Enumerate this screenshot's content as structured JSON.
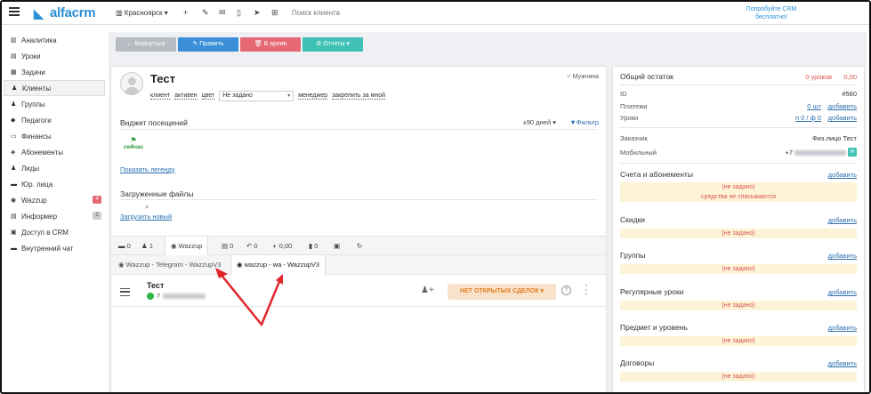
{
  "topbar": {
    "logo": "alfacrm",
    "branch": "Красноярск",
    "search_placeholder": "Поиск клиента",
    "promo": "Попробуйте CRM бесплатно!"
  },
  "sidebar": {
    "items": [
      {
        "label": "Аналитика",
        "icon": "chart-icon"
      },
      {
        "label": "Уроки",
        "icon": "calendar-icon"
      },
      {
        "label": "Задачи",
        "icon": "tasks-icon"
      },
      {
        "label": "Клиенты",
        "icon": "user-icon"
      },
      {
        "label": "Группы",
        "icon": "users-icon"
      },
      {
        "label": "Педагоги",
        "icon": "graduation-cap-icon"
      },
      {
        "label": "Финансы",
        "icon": "money-icon"
      },
      {
        "label": "Абонементы",
        "icon": "tag-icon"
      },
      {
        "label": "Лиды",
        "icon": "lead-icon"
      },
      {
        "label": "Юр. лица",
        "icon": "company-icon"
      },
      {
        "label": "Wazzup",
        "icon": "whatsapp-icon",
        "badge": "4"
      },
      {
        "label": "Информер",
        "icon": "list-icon",
        "badge": "2"
      },
      {
        "label": "Доступ в CRM",
        "icon": "lock-icon"
      },
      {
        "label": "Внутренний чат",
        "icon": "chat-icon"
      }
    ]
  },
  "actions": {
    "back": "← Вернуться",
    "edit": "✎ Править",
    "archive": "🗑 В архив",
    "reports": "⚙ Отчеты ▾"
  },
  "client": {
    "name": "Тест",
    "gender": "Мужчина",
    "status_client": "клиент",
    "status_active": "активен",
    "color": "цвет",
    "manager_value": "Не задано",
    "manager": "менеджер",
    "assign_me": "закрепить за мной"
  },
  "attendance": {
    "title": "Виджет посещений",
    "range": "±90 дней ▾",
    "filter": "Фильтр",
    "flag_label": "сейчас",
    "legend": "Показать легенду"
  },
  "files": {
    "title": "Загруженные файлы",
    "upload": "Загрузить новый"
  },
  "tabs": {
    "items": [
      "0",
      "1",
      "Wazzup",
      "0",
      "0",
      "0,00",
      "0",
      "",
      ""
    ]
  },
  "subtabs": {
    "telegram": "Wazzup - Telegram - WazzupV3",
    "wa": "wazzup - wa - WazzupV3"
  },
  "chat": {
    "name": "Тест",
    "phone_prefix": "7",
    "deals_button": "НЕТ ОТКРЫТЫХ СДЕЛОК"
  },
  "right": {
    "balance_title": "Общий остаток",
    "balance_lessons": "0 уроков",
    "balance_amount": "0,00",
    "id_label": "ID",
    "id_value": "#560",
    "payments_label": "Платежи",
    "payments_value": "0 шт",
    "lessons_label": "Уроки",
    "lessons_value": "п 0 / ф 0",
    "add": "добавить",
    "customer_label": "Заказчик",
    "customer_value": "Физ.лицо Тест",
    "mobile_label": "Мобильный",
    "mobile_prefix": "+7",
    "accounts_title": "Счета и абонементы",
    "not_set": "(не задано)",
    "no_write_off": "средства не списываются",
    "discounts_title": "Скидки",
    "groups_title": "Группы",
    "regular_title": "Регулярные уроки",
    "subject_title": "Предмет и уровень",
    "contracts_title": "Договоры"
  },
  "colors": {
    "accent": "#2a8fd6",
    "btn_back": "#b8bcc2",
    "btn_edit": "#3a8fd8",
    "btn_archive": "#e56874",
    "btn_reports": "#3fc1b5",
    "warn_bg": "#fdf3d7",
    "arrow": "#e0262a"
  }
}
